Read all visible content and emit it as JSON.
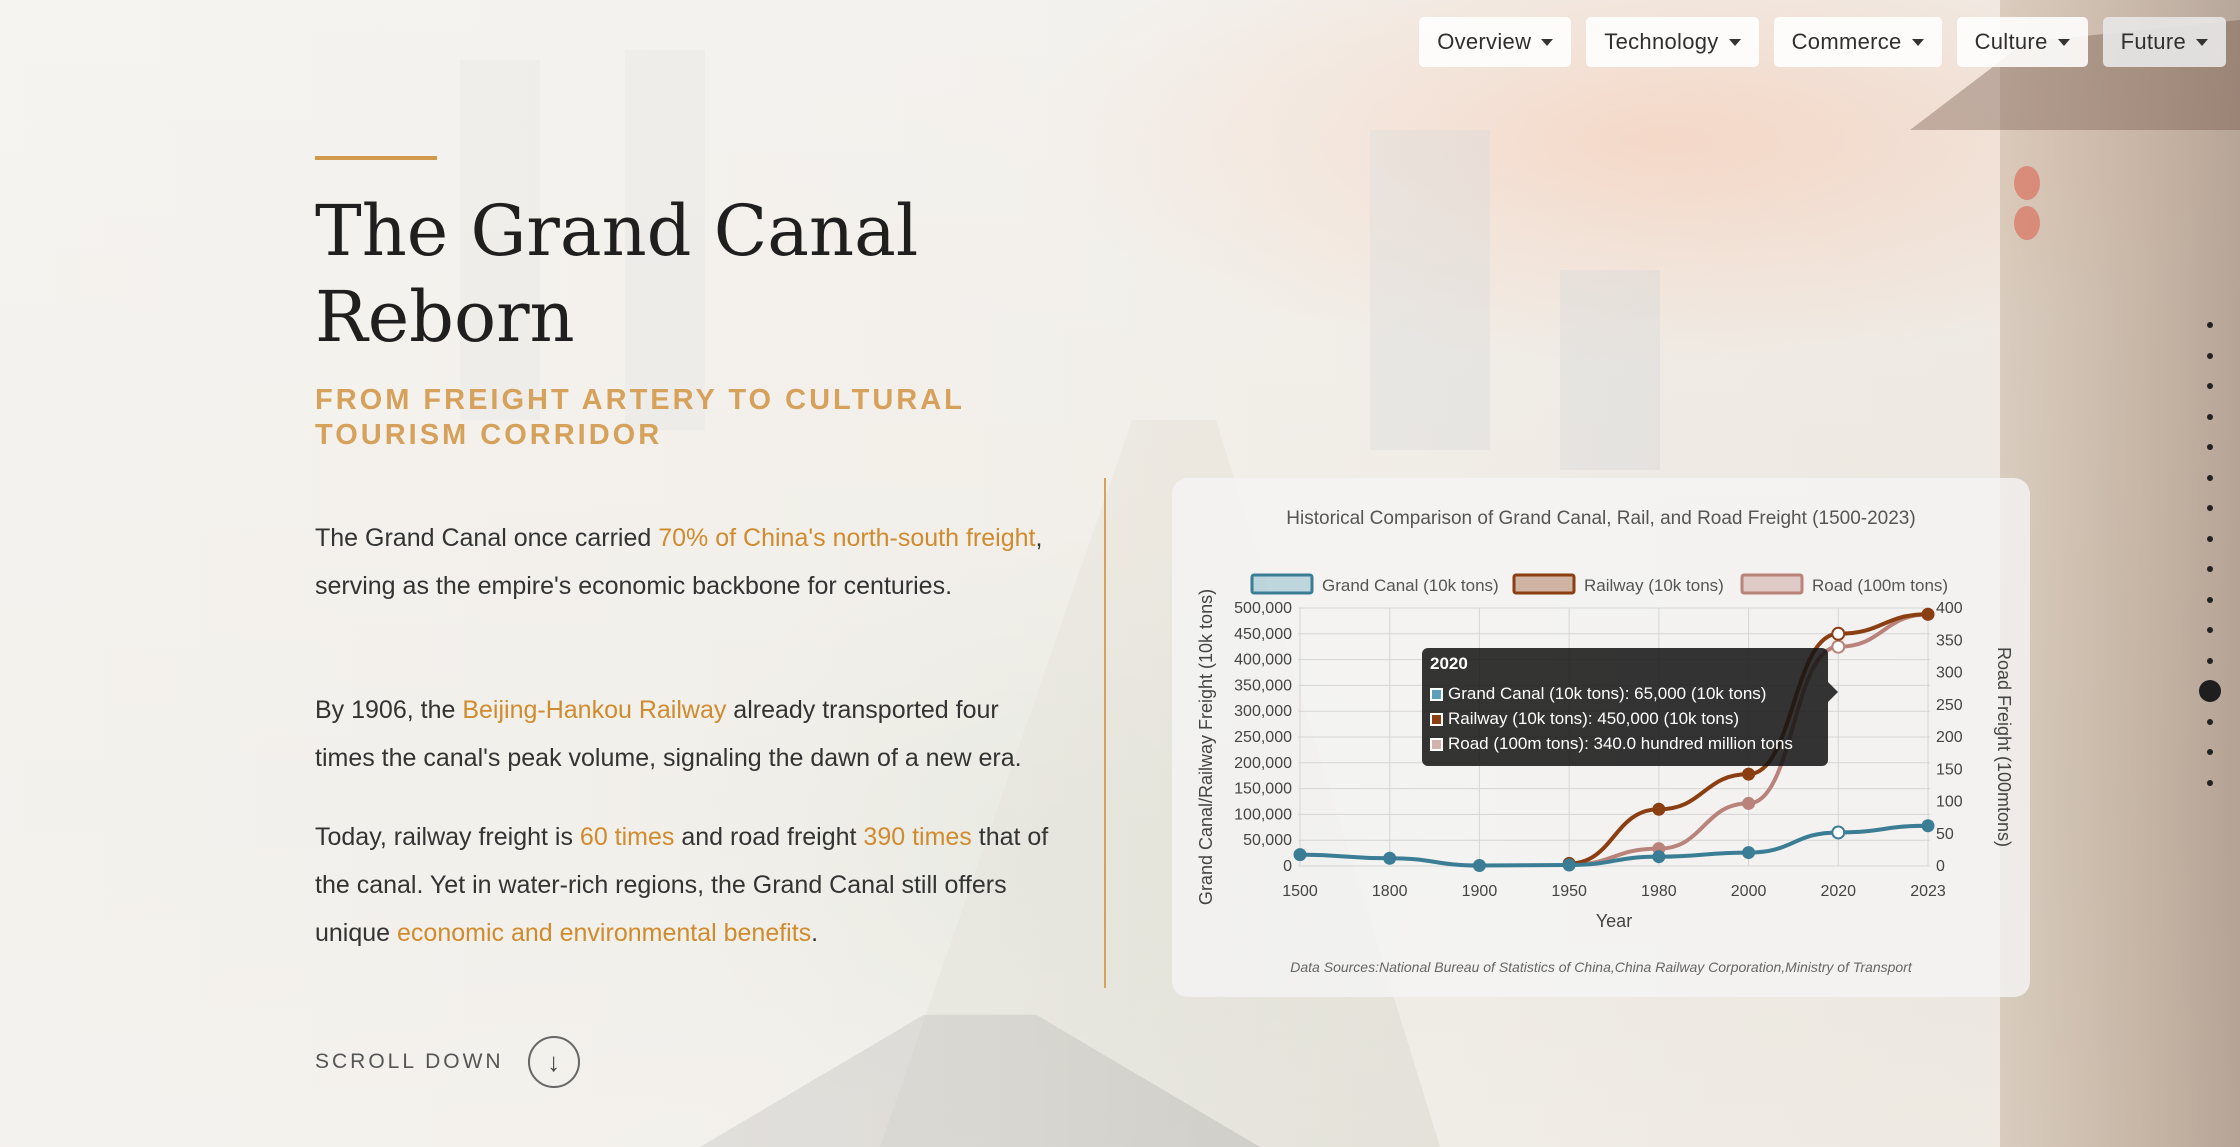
{
  "nav": {
    "items": [
      {
        "label": "Overview"
      },
      {
        "label": "Technology"
      },
      {
        "label": "Commerce"
      },
      {
        "label": "Culture"
      },
      {
        "label": "Future"
      }
    ]
  },
  "hero": {
    "title": "The Grand Canal Reborn",
    "subtitle": "FROM FREIGHT ARTERY TO CULTURAL TOURISM CORRIDOR",
    "p1": {
      "a": "The Grand Canal once carried ",
      "hl1": "70% of China's north-south freight",
      "b": ", serving as the empire's economic backbone for centuries."
    },
    "p2": {
      "a": "By 1906, the ",
      "hl1": "Beijing-Hankou Railway",
      "b": " already transported four times the canal's peak volume, signaling the dawn of a new era."
    },
    "p3": {
      "a": "Today, railway freight is ",
      "hl1": "60 times",
      "b": " and road freight ",
      "hl2": "390 times",
      "c": " that of the canal. Yet in water-rich regions, the Grand Canal still offers unique ",
      "hl3": "economic and environmental benefits",
      "d": "."
    },
    "scroll_label": "SCROLL DOWN",
    "scroll_icon": "arrow-down-icon",
    "accent_color": "#cf8b2e"
  },
  "section_dots": {
    "count": 16,
    "active_index": 12
  },
  "chart_data": {
    "type": "line",
    "title": "Historical Comparison of Grand Canal, Rail, and Road Freight (1500-2023)",
    "categories": [
      "1500",
      "1800",
      "1900",
      "1950",
      "1980",
      "2000",
      "2020",
      "2023"
    ],
    "xlabel": "Year",
    "ylabel": "Grand Canal/Railway Freight (10k tons)",
    "y2label": "Road Freight (100mtons)",
    "ylim": [
      0,
      500000
    ],
    "y2lim": [
      0,
      400
    ],
    "yticks": [
      "0",
      "50,000",
      "100,000",
      "150,000",
      "200,000",
      "250,000",
      "300,000",
      "350,000",
      "400,000",
      "450,000",
      "500,000"
    ],
    "y2ticks": [
      "0",
      "50",
      "100",
      "150",
      "200",
      "250",
      "300",
      "350",
      "400"
    ],
    "series": [
      {
        "name": "Grand Canal (10k tons)",
        "color": "#3a7d94",
        "axis": "left",
        "values": [
          22000,
          15000,
          1000,
          2000,
          18000,
          26000,
          65000,
          78000
        ]
      },
      {
        "name": "Railway (10k tons)",
        "color": "#8b3e12",
        "axis": "left",
        "values": [
          null,
          null,
          null,
          5000,
          110000,
          178000,
          450000,
          488000
        ]
      },
      {
        "name": "Road (100m tons)",
        "color": "#b9827a",
        "axis": "right",
        "values": [
          null,
          null,
          null,
          2,
          27,
          97,
          340,
          390
        ]
      }
    ],
    "legend_position": "top",
    "grid": true,
    "source": "Data Sources:National Bureau of Statistics of China,China Railway Corporation,Ministry of Transport",
    "tooltip": {
      "title": "2020",
      "rows": [
        "Grand Canal (10k tons): 65,000 (10k tons)",
        "Railway (10k tons): 450,000 (10k tons)",
        "Road (100m tons): 340.0 hundred million tons"
      ]
    }
  }
}
